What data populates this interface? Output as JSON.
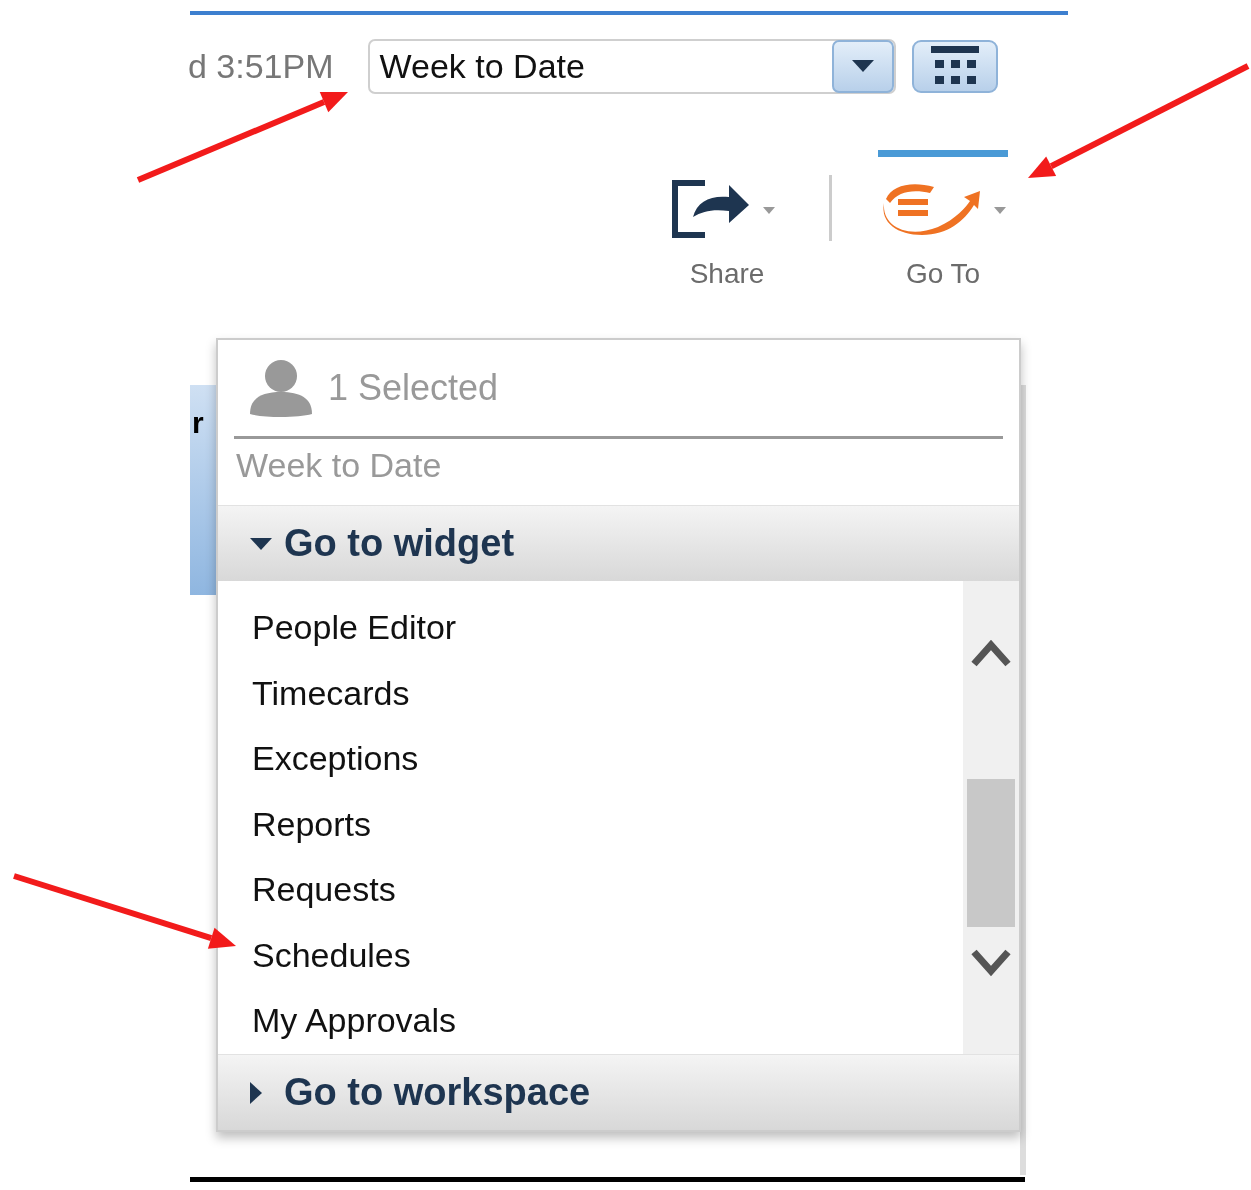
{
  "header": {
    "time": "d 3:51PM",
    "period_field": {
      "value": "Week to Date"
    }
  },
  "toolbar": [
    {
      "label": "Share",
      "kind": "share",
      "selected": false
    },
    {
      "label": "Go To",
      "kind": "goto",
      "selected": true
    }
  ],
  "background_tab": {
    "label": "r"
  },
  "goto_menu": {
    "selection": "1 Selected",
    "period": "Week to Date",
    "sections": [
      {
        "title": "Go to widget",
        "expanded": true,
        "items": [
          "People Editor",
          "Timecards",
          "Exceptions",
          "Reports",
          "Requests",
          "Schedules",
          "My Approvals"
        ]
      },
      {
        "title": "Go to workspace",
        "expanded": false
      }
    ]
  }
}
